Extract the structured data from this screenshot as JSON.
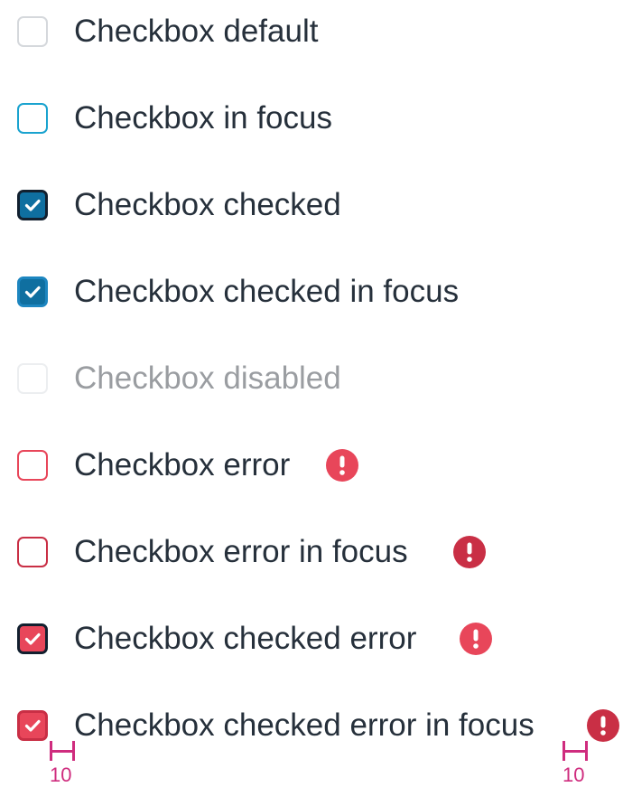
{
  "checkboxes": [
    {
      "label": "Checkbox default",
      "state": "default",
      "checked": false,
      "error": false
    },
    {
      "label": "Checkbox in focus",
      "state": "focus",
      "checked": false,
      "error": false
    },
    {
      "label": "Checkbox checked",
      "state": "checked",
      "checked": true,
      "error": false
    },
    {
      "label": "Checkbox checked in focus",
      "state": "checked-focus",
      "checked": true,
      "error": false
    },
    {
      "label": "Checkbox disabled",
      "state": "disabled",
      "checked": false,
      "error": false
    },
    {
      "label": "Checkbox error",
      "state": "error",
      "checked": false,
      "error": true
    },
    {
      "label": "Checkbox error in focus",
      "state": "error-focus",
      "checked": false,
      "error": true
    },
    {
      "label": "Checkbox checked error",
      "state": "checked-error",
      "checked": true,
      "error": true
    },
    {
      "label": "Checkbox checked error in focus",
      "state": "checked-error-focus",
      "checked": true,
      "error": true
    }
  ],
  "icons": {
    "check": "check-icon",
    "error": "exclamation-circle-icon"
  },
  "colors": {
    "text": "#26303b",
    "disabled_text": "#9a9da1",
    "focus": "#1aa3cf",
    "checked_fill": "#0f6fa0",
    "error": "#e8465a",
    "error_focus": "#c92f45",
    "measure": "#cf2c7e"
  },
  "spacing_annotations": {
    "left": "10",
    "right": "10"
  }
}
